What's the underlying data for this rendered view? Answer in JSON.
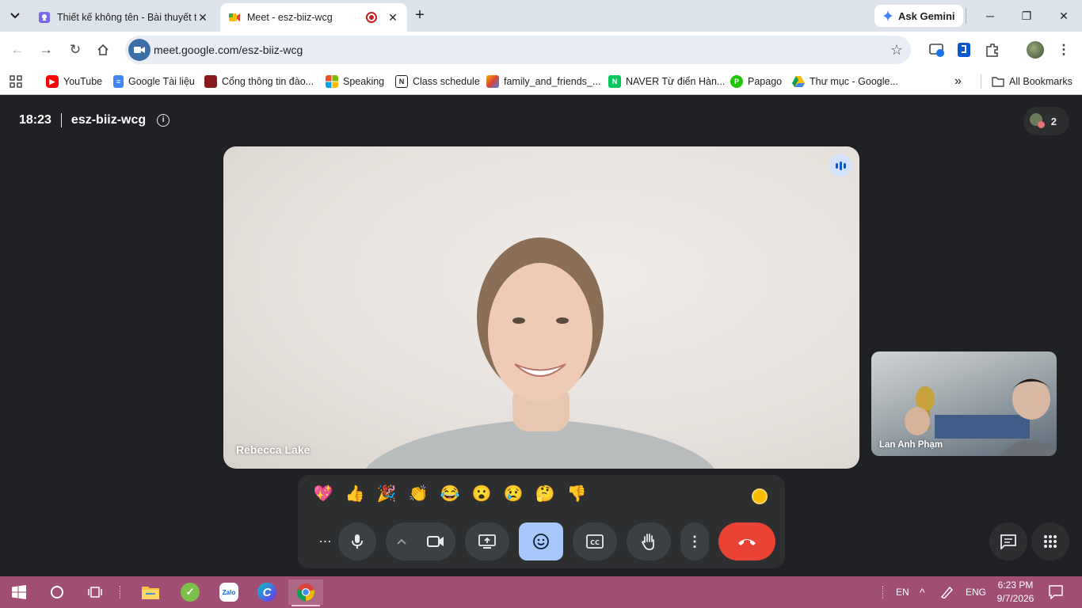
{
  "browser": {
    "tabs": [
      {
        "title": "Thiết kế không tên - Bài thuyết trình",
        "active": false
      },
      {
        "title": "Meet - esz-biiz-wcg",
        "active": true
      }
    ],
    "ask_gemini": "Ask Gemini",
    "url": "meet.google.com/esz-biiz-wcg",
    "bookmarks": [
      {
        "label": "YouTube",
        "icon": "youtube-icon"
      },
      {
        "label": "Google Tài liệu",
        "icon": "google-docs-icon"
      },
      {
        "label": "Cổng thông tin đào...",
        "icon": "portal-icon"
      },
      {
        "label": "Speaking",
        "icon": "windows-logo-icon"
      },
      {
        "label": "Class schedule",
        "icon": "notion-icon"
      },
      {
        "label": "family_and_friends_...",
        "icon": "book-icon"
      },
      {
        "label": "NAVER Từ điển Hàn...",
        "icon": "naver-icon"
      },
      {
        "label": "Papago",
        "icon": "papago-icon"
      },
      {
        "label": "Thư mục - Google...",
        "icon": "google-drive-icon"
      }
    ],
    "all_bookmarks": "All Bookmarks"
  },
  "meet": {
    "time": "18:23",
    "meeting_code": "esz-biiz-wcg",
    "participant_count": "2",
    "main_participant": "Rebecca Lake",
    "side_participant": "Lan Anh Phạm",
    "reactions": [
      "💖",
      "👍",
      "🎉",
      "👏",
      "😂",
      "😮",
      "😢",
      "🤔",
      "👎"
    ],
    "colors": {
      "end_call": "#ea4335",
      "active_control": "#a8c7fa",
      "background": "#202124"
    }
  },
  "taskbar": {
    "lang": "EN",
    "input": "ENG",
    "time": "6:23 PM",
    "date": "9/7/2026",
    "color": "#a04e73"
  }
}
